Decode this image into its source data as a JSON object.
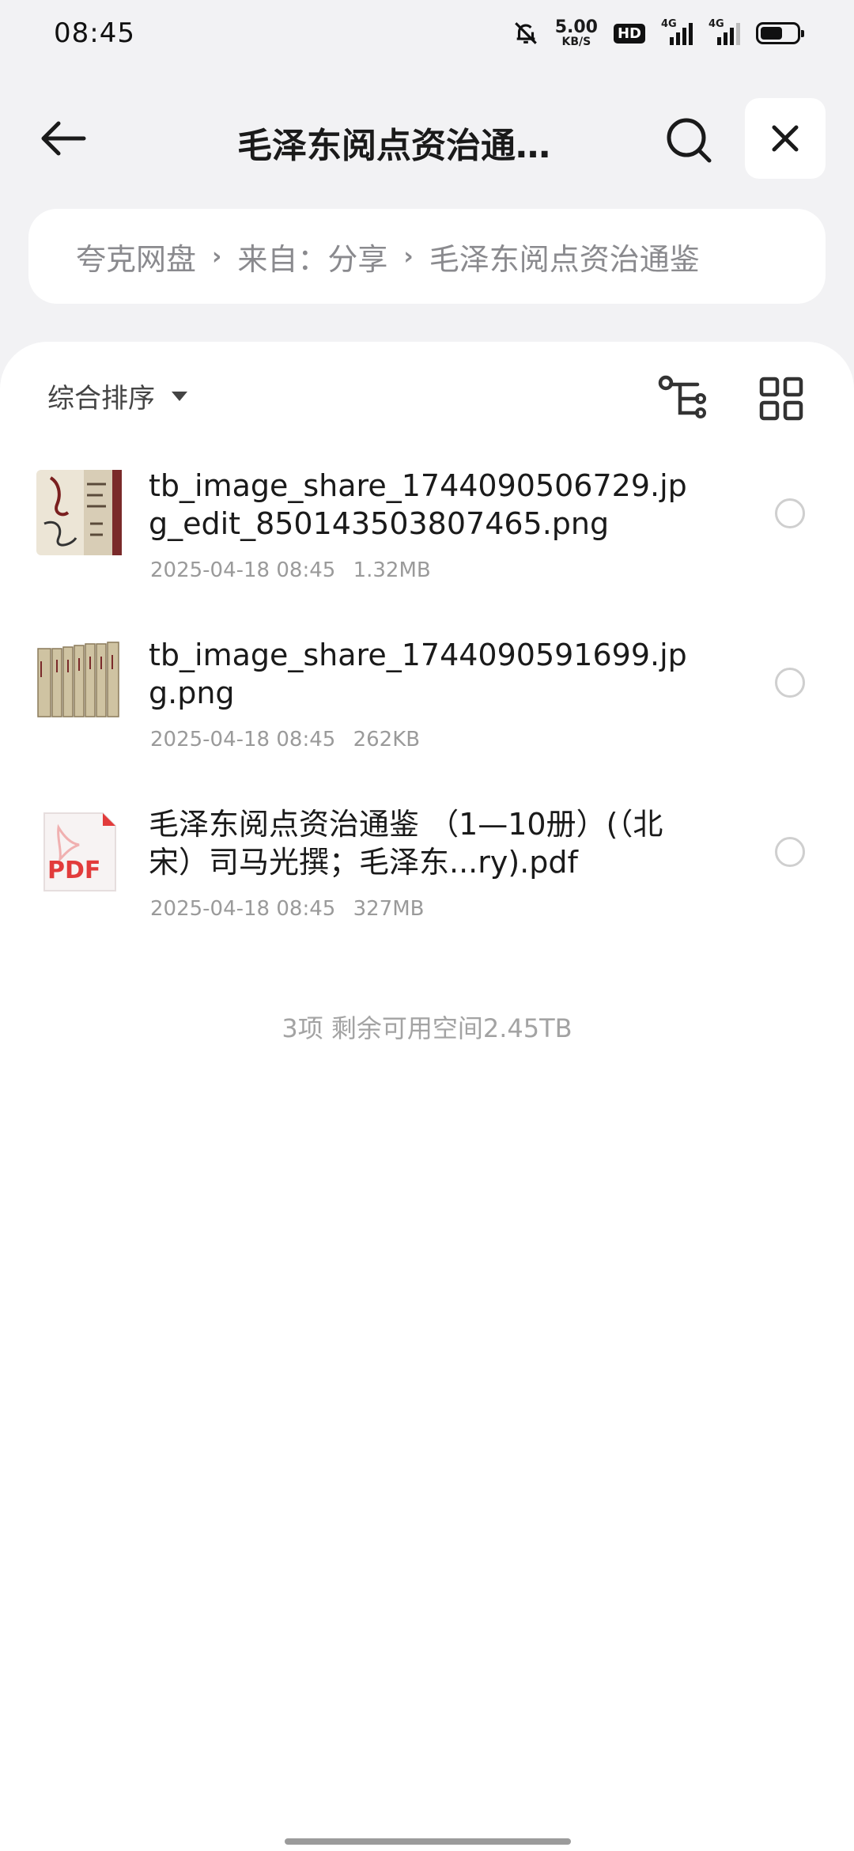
{
  "status_bar": {
    "time": "08:45",
    "net_speed_value": "5.00",
    "net_speed_unit": "KB/S",
    "hd_badge": "HD",
    "signal1_label": "4G",
    "signal2_label": "4G",
    "battery_level": 0.62,
    "icons": [
      "bell-muted-icon",
      "signal-icon",
      "battery-icon"
    ]
  },
  "header": {
    "title": "毛泽东阅点资治通…",
    "icons": [
      "back-arrow-icon",
      "search-icon",
      "close-icon"
    ]
  },
  "breadcrumb": {
    "items": [
      "夸克网盘",
      "来自：分享",
      "毛泽东阅点资治通鉴"
    ],
    "separator": "›"
  },
  "toolbar": {
    "sort_label": "综合排序",
    "icons": [
      "chevron-down-icon",
      "tree-view-icon",
      "grid-view-icon"
    ]
  },
  "files": [
    {
      "name": "tb_image_share_1744090506729.jpg_edit_850143503807465.png",
      "date": "2025-04-18 08:45",
      "size": "1.32MB",
      "thumb": "book-cover-thumbnail"
    },
    {
      "name": "tb_image_share_1744090591699.jpg.png",
      "date": "2025-04-18 08:45",
      "size": "262KB",
      "thumb": "book-set-thumbnail"
    },
    {
      "name": "毛泽东阅点资治通鉴 （1—10册）(（北宋）司马光撰；毛泽东...ry).pdf",
      "date": "2025-04-18 08:45",
      "size": "327MB",
      "thumb": "pdf-icon",
      "thumb_label": "PDF"
    }
  ],
  "summary": "3项 剩余可用空间2.45TB",
  "colors": {
    "background": "#f2f2f4",
    "card": "#ffffff",
    "secondary_text": "#9a9a9a",
    "pdf_red": "#e23b3b"
  }
}
